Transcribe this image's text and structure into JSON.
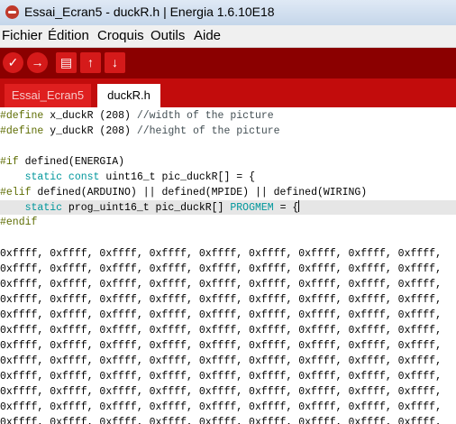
{
  "window": {
    "title": "Essai_Ecran5 - duckR.h | Energia 1.6.10E18"
  },
  "menu": [
    "Fichier",
    "Édition",
    "Croquis",
    "Outils",
    "Aide"
  ],
  "toolbar": {
    "verify_icon": "✓",
    "upload_icon": "→",
    "new_icon": "▤",
    "open_icon": "↑",
    "save_icon": "↓"
  },
  "tabs": {
    "inactive": "Essai_Ecran5",
    "active": "duckR.h"
  },
  "code": {
    "l1_pp": "#define",
    "l1_a": " x_duckR (208) ",
    "l1_c": "//width of the picture",
    "l2_pp": "#define",
    "l2_a": " y_duckR (208) ",
    "l2_c": "//height of the picture",
    "l4_pp": "#if",
    "l4_a": " defined(ENERGIA)",
    "l5_indent": "    ",
    "l5_kw": "static const",
    "l5_a": " uint16_t pic_duckR[] = {",
    "l6_pp": "#elif",
    "l6_a": " defined(ARDUINO) || defined(MPIDE) || defined(WIRING)",
    "l7_indent": "    ",
    "l7_kw": "static",
    "l7_a": " prog_uint16_t pic_duckR[] ",
    "l7_kw2": "PROGMEM",
    "l7_b": " = {",
    "l8_pp": "#endif",
    "hex_row": "0xffff, 0xffff, 0xffff, 0xffff, 0xffff, 0xffff, 0xffff, 0xffff, 0xffff,"
  },
  "colors": {
    "toolbar": "#8b0000",
    "tabbar": "#c20c0c",
    "preprocessor": "#5e6d03",
    "keyword": "#00979c"
  }
}
